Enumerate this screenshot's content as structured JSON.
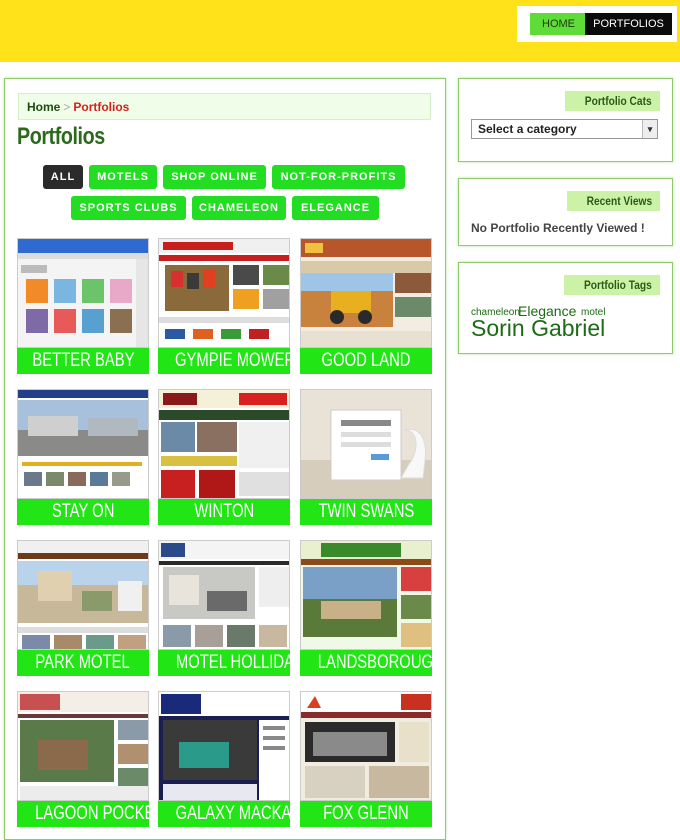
{
  "nav": {
    "home": "HOME",
    "portfolios": "PORTFOLIOS"
  },
  "breadcrumb": {
    "home": "Home",
    "separator": ">",
    "current": "Portfolios"
  },
  "page_title": "Portfolios",
  "filters": [
    "ALL",
    "MOTELS",
    "SHOP ONLINE",
    "NOT-FOR-PROFITS",
    "SPORTS CLUBS",
    "CHAMELEON",
    "ELEGANCE"
  ],
  "portfolio_items": [
    "BETTER BABY",
    "GYMPIE MOWER",
    "GOOD LAND",
    "STAY ON",
    "WINTON",
    "TWIN SWANS",
    "PARK MOTEL",
    "MOTEL HOLLIDAY",
    "LANDSBOROUGH",
    "LAGOON POCKET",
    "GALAXY MACKAY",
    "FOX GLENN"
  ],
  "sidebar": {
    "cats": {
      "title": "Portfolio Cats",
      "select_value": "Select a category"
    },
    "recent": {
      "title": "Recent Views",
      "empty_text": "No Portfolio Recently Viewed !"
    },
    "tags": {
      "title": "Portfolio Tags",
      "items": [
        "chameleon",
        "Elegance",
        "motel",
        "Sorin Gabriel"
      ]
    }
  },
  "colors": {
    "topbar": "#ffe21a",
    "accent_green": "#22e515",
    "active_filter": "#2b2b2b",
    "title_green": "#2a6a1a",
    "crumb_current": "#d3201c"
  }
}
